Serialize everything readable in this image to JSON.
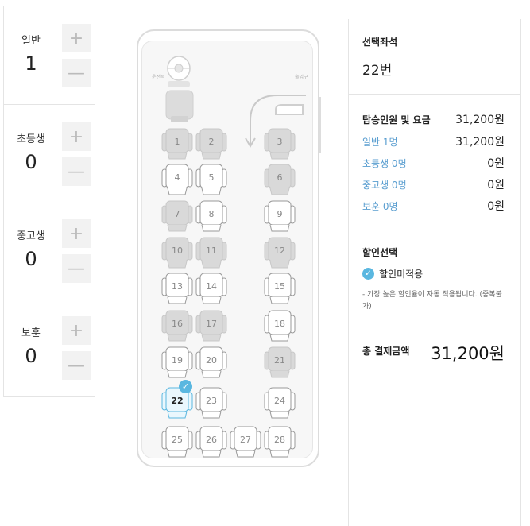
{
  "passengers": [
    {
      "label": "일반",
      "count": "1"
    },
    {
      "label": "초등생",
      "count": "0"
    },
    {
      "label": "중고생",
      "count": "0"
    },
    {
      "label": "보훈",
      "count": "0"
    }
  ],
  "stepper": {
    "plus": "+",
    "minus": "—"
  },
  "bus": {
    "driver_label": "운전석",
    "door_label": "출입구"
  },
  "seats": [
    {
      "num": "1",
      "status": "taken"
    },
    {
      "num": "2",
      "status": "taken"
    },
    {
      "num": "3",
      "status": "taken"
    },
    {
      "num": "4",
      "status": "available"
    },
    {
      "num": "5",
      "status": "available"
    },
    {
      "num": "6",
      "status": "taken"
    },
    {
      "num": "7",
      "status": "taken"
    },
    {
      "num": "8",
      "status": "available"
    },
    {
      "num": "9",
      "status": "available"
    },
    {
      "num": "10",
      "status": "taken"
    },
    {
      "num": "11",
      "status": "taken"
    },
    {
      "num": "12",
      "status": "taken"
    },
    {
      "num": "13",
      "status": "available"
    },
    {
      "num": "14",
      "status": "available"
    },
    {
      "num": "15",
      "status": "available"
    },
    {
      "num": "16",
      "status": "taken"
    },
    {
      "num": "17",
      "status": "taken"
    },
    {
      "num": "18",
      "status": "available"
    },
    {
      "num": "19",
      "status": "available"
    },
    {
      "num": "20",
      "status": "available"
    },
    {
      "num": "21",
      "status": "taken"
    },
    {
      "num": "22",
      "status": "selected"
    },
    {
      "num": "23",
      "status": "available"
    },
    {
      "num": "24",
      "status": "available"
    },
    {
      "num": "25",
      "status": "available"
    },
    {
      "num": "26",
      "status": "available"
    },
    {
      "num": "27",
      "status": "available"
    },
    {
      "num": "28",
      "status": "available"
    }
  ],
  "summary": {
    "selected_title": "선택좌석",
    "selected_value": "22번",
    "fare_title": "탑승인원 및 요금",
    "fare_total": "31,200원",
    "rows": [
      {
        "label": "일반 1명",
        "value": "31,200원"
      },
      {
        "label": "초등생 0명",
        "value": "0원"
      },
      {
        "label": "중고생 0명",
        "value": "0원"
      },
      {
        "label": "보훈 0명",
        "value": "0원"
      }
    ],
    "discount_title": "할인선택",
    "discount_option": "할인미적용",
    "discount_note": "- 가장 높은 할인율이 자동 적용됩니다. (중복불가)",
    "total_title": "총 결제금액",
    "total_value": "31,200원"
  },
  "colors": {
    "accent": "#5ab7e0",
    "taken": "#d9d9d9",
    "available": "#ffffff",
    "link": "#5a9ed0"
  }
}
